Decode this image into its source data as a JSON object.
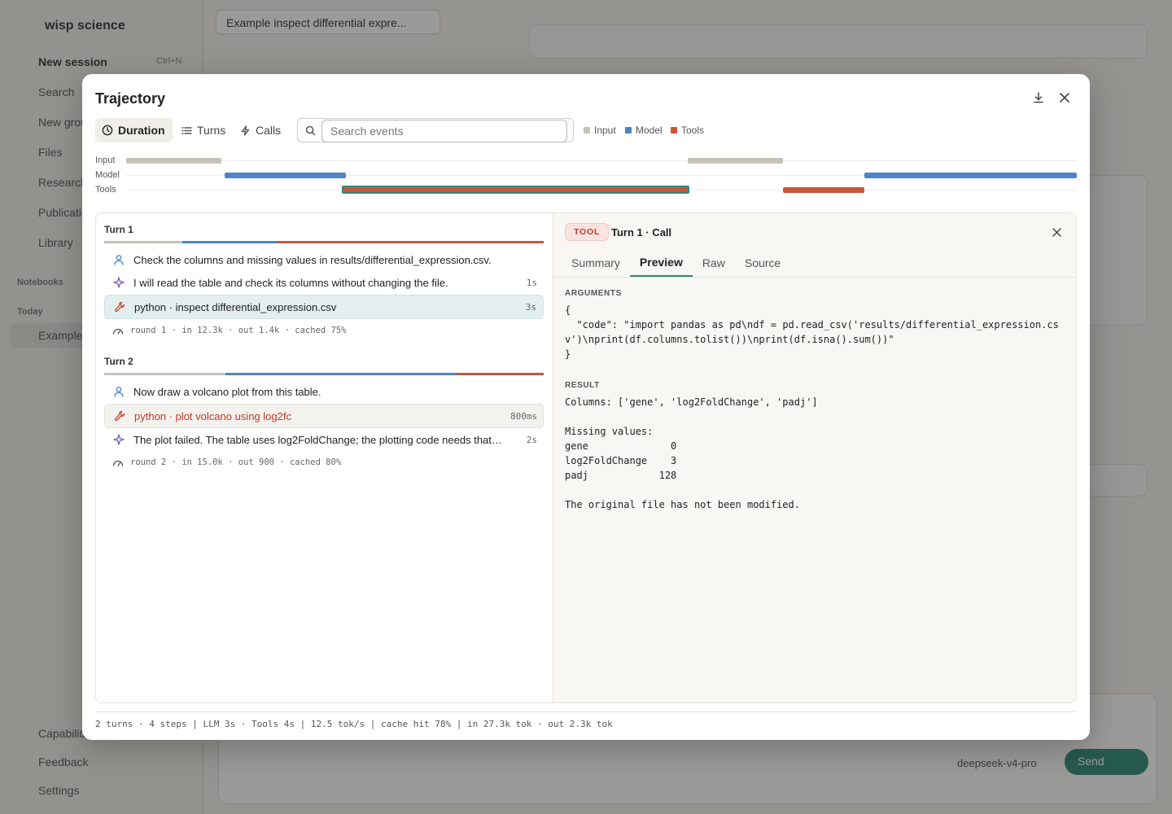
{
  "background": {
    "brand": "wisp science",
    "new_session": "New session",
    "new_session_kbd": "Ctrl+N",
    "sidebar_items": [
      "Search",
      "New group",
      "Files",
      "Research",
      "Publications",
      "Library"
    ],
    "sections": [
      "Notebooks",
      "Today"
    ],
    "selected_session": "Example",
    "bottom_items": [
      "Capabilities",
      "Feedback",
      "Settings"
    ],
    "top_tab": "Example inspect differential expre...",
    "send_label": "Send",
    "model_label": "deepseek-v4-pro"
  },
  "modal": {
    "title": "Trajectory",
    "views": [
      "Duration",
      "Turns",
      "Calls"
    ],
    "active_view": "Duration",
    "search_placeholder": "Search events",
    "legend": [
      {
        "label": "Input",
        "color": "#c4c2bb"
      },
      {
        "label": "Model",
        "color": "#4a86c8"
      },
      {
        "label": "Tools",
        "color": "#c9553a"
      }
    ],
    "tracks": [
      "Input",
      "Model",
      "Tools"
    ],
    "turns": [
      {
        "label": "Turn 1",
        "events": [
          {
            "kind": "user",
            "text": "Check the columns and missing values in results/differential_expression.csv.",
            "duration": ""
          },
          {
            "kind": "model",
            "text": "I will read the table and check its columns without changing the file.",
            "duration": "1s"
          },
          {
            "kind": "tool",
            "text": "python · inspect differential_expression.csv",
            "duration": "3s"
          }
        ],
        "meta": "round 1 · in 12.3k · out 1.4k · cached 75%"
      },
      {
        "label": "Turn 2",
        "events": [
          {
            "kind": "user",
            "text": "Now draw a volcano plot from this table.",
            "duration": ""
          },
          {
            "kind": "tool-error",
            "text": "python · plot volcano using log2fc",
            "duration": "800ms"
          },
          {
            "kind": "model",
            "text": "The plot failed. The table uses log2FoldChange; the plotting code needs that column name.",
            "duration": "2s"
          }
        ],
        "meta": "round 2 · in 15.0k · out 900 · cached 80%"
      }
    ],
    "detail": {
      "badge": "TOOL",
      "title": "Turn 1 · Call",
      "tabs": [
        "Summary",
        "Preview",
        "Raw",
        "Source"
      ],
      "active_tab": "Preview",
      "arguments_heading": "ARGUMENTS",
      "arguments": "{\n  \"code\": \"import pandas as pd\\ndf = pd.read_csv('results/differential_expression.csv')\\nprint(df.columns.tolist())\\nprint(df.isna().sum())\"\n}",
      "result_heading": "RESULT",
      "result": "Columns: ['gene', 'log2FoldChange', 'padj']\n\nMissing values:\ngene              0\nlog2FoldChange    3\npadj            128\n\nThe original file has not been modified."
    },
    "footer": "2 turns · 4 steps | LLM 3s · Tools 4s | 12.5 tok/s | cache hit 78% | in 27.3k tok · out 2.3k tok"
  }
}
